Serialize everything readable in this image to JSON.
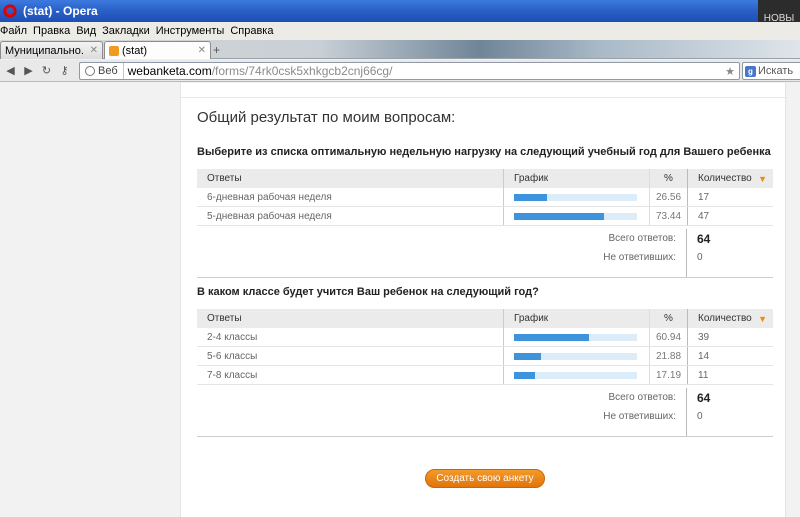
{
  "window": {
    "title": "(stat) - Opera",
    "news_label": "НОВЫ"
  },
  "menu": [
    "Файл",
    "Правка",
    "Вид",
    "Закладки",
    "Инструменты",
    "Справка"
  ],
  "tabs": [
    {
      "label": "Муниципально...",
      "active": false
    },
    {
      "label": "(stat)",
      "active": true
    }
  ],
  "address": {
    "badge": "Веб",
    "domain": "webanketa.com",
    "path": "/forms/74rk0csk5xhkgcb2cnj66cg/",
    "search_placeholder": "Искать"
  },
  "page": {
    "title": "Общий результат по моим вопросам:",
    "headers": {
      "answers": "Ответы",
      "graph": "График",
      "percent": "%",
      "count": "Количество"
    },
    "total_label": "Всего ответов:",
    "unanswered_label": "Не ответивших:",
    "create_button": "Создать свою анкету",
    "questions": [
      {
        "title": "Выберите из списка оптимальную недельную нагрузку на следующий учебный год для Вашего ребенка",
        "rows": [
          {
            "answer": "6-дневная рабочая неделя",
            "percent": "26.56",
            "count": "17"
          },
          {
            "answer": "5-дневная рабочая неделя",
            "percent": "73.44",
            "count": "47"
          }
        ],
        "total": "64",
        "unanswered": "0"
      },
      {
        "title": "В каком классе будет учится Ваш ребенок на следующий год?",
        "rows": [
          {
            "answer": "2-4 классы",
            "percent": "60.94",
            "count": "39"
          },
          {
            "answer": "5-6 классы",
            "percent": "21.88",
            "count": "14"
          },
          {
            "answer": "7-8 классы",
            "percent": "17.19",
            "count": "11"
          }
        ],
        "total": "64",
        "unanswered": "0"
      }
    ]
  },
  "colors": {
    "bar": "#3d94dd",
    "bar_track": "#dcecf8",
    "button": "#e2740b"
  }
}
